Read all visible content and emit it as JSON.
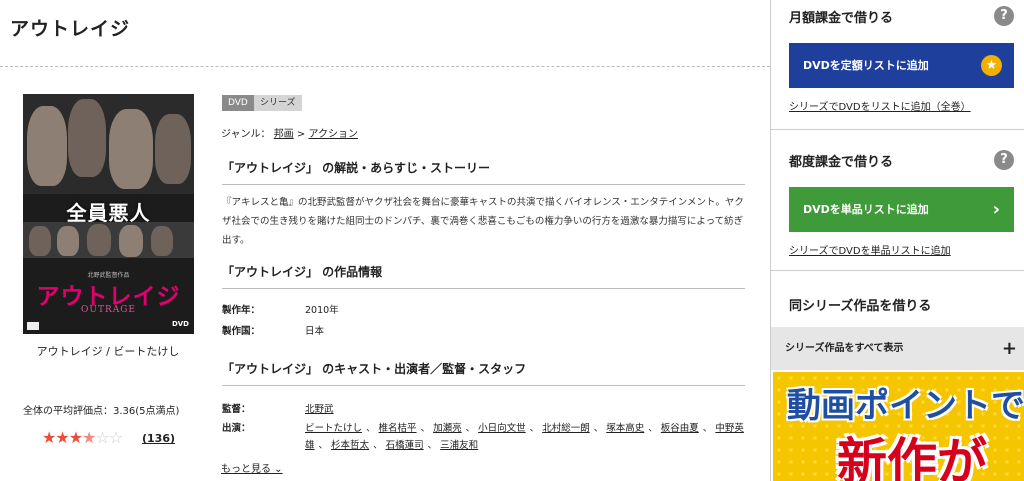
{
  "page": {
    "title": "アウトレイジ"
  },
  "poster": {
    "tagline": "全員悪人",
    "director_credit": "北野武監督作品",
    "logo": "アウトレイジ",
    "logo_en": "OUTRAGE",
    "dvd_mark": "DVD",
    "caption": "アウトレイジ / ビートたけし"
  },
  "rating": {
    "label": "全体の平均評価点：3.36(5点満点)",
    "stars": [
      {
        "glyph": "★",
        "state": "full"
      },
      {
        "glyph": "★",
        "state": "full"
      },
      {
        "glyph": "★",
        "state": "full"
      },
      {
        "glyph": "★",
        "state": "half"
      },
      {
        "glyph": "☆",
        "state": "empty"
      },
      {
        "glyph": "☆",
        "state": "empty"
      }
    ],
    "count": "(136)"
  },
  "tags": {
    "dvd": "DVD",
    "series": "シリーズ"
  },
  "genre": {
    "label": "ジャンル：",
    "main": "邦画",
    "sep": ">",
    "sub": "アクション"
  },
  "synopsis": {
    "heading": "「アウトレイジ」 の解説・あらすじ・ストーリー",
    "text": "『アキレスと亀』の北野武監督がヤクザ社会を舞台に豪華キャストの共演で描くバイオレンス・エンタテインメント。ヤクザ社会での生き残りを賭けた組同士のドンパチ、裏で渦巻く悲喜こもごもの権力争いの行方を過激な暴力描写によって紡ぎ出す。"
  },
  "work_info": {
    "heading": "「アウトレイジ」 の作品情報",
    "year_label": "製作年：",
    "year": "2010年",
    "country_label": "製作国：",
    "country": "日本"
  },
  "cast": {
    "heading": "「アウトレイジ」 のキャスト・出演者／監督・スタッフ",
    "director_label": "監督：",
    "director": "北野武",
    "cast_label": "出演：",
    "members": [
      "ビートたけし",
      "椎名桔平",
      "加瀬亮",
      "小日向文世",
      "北村総一朗",
      "塚本高史",
      "板谷由夏",
      "中野英雄",
      "杉本哲太",
      "石橋蓮司",
      "三浦友和"
    ],
    "more": "もっと見る ⌄"
  },
  "sidebar": {
    "monthly": {
      "heading": "月額課金で借りる",
      "help": "?",
      "button": "DVDを定額リストに追加",
      "button_icon": "★",
      "link": "シリーズでDVDをリストに追加（全巻）"
    },
    "single": {
      "heading": "都度課金で借りる",
      "help": "?",
      "button": "DVDを単品リストに追加",
      "button_icon": "›",
      "link": "シリーズでDVDを単品リストに追加"
    },
    "series": {
      "heading": "同シリーズ作品を借りる",
      "bar": "シリーズ作品をすべて表示",
      "bar_icon": "+"
    },
    "banner": {
      "line1": "動画ポイントで",
      "line2": "新作が"
    }
  },
  "colors": {
    "blue_button": "#1e3f9c",
    "green_button": "#3f9a3a",
    "star": "#e94e3c",
    "banner_bg": "#f5c500"
  }
}
